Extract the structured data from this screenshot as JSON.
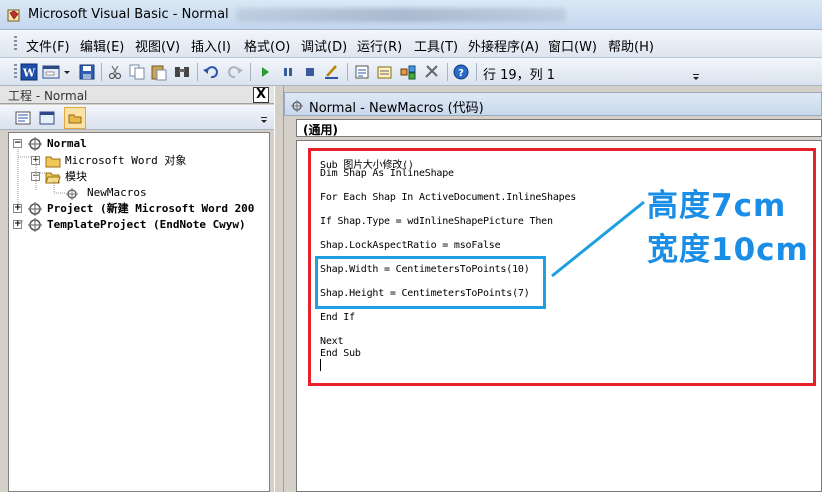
{
  "window": {
    "title": "Microsoft Visual Basic - Normal"
  },
  "menu": {
    "items": [
      "文件(F)",
      "编辑(E)",
      "视图(V)",
      "插入(I)",
      "格式(O)",
      "调试(D)",
      "运行(R)",
      "工具(T)",
      "外接程序(A)",
      "窗口(W)",
      "帮助(H)"
    ]
  },
  "toolbar": {
    "cursor_position": "行 19，列 1"
  },
  "project_explorer": {
    "title": "工程 - Normal",
    "close_label": "X",
    "tree": [
      {
        "label": "Normal",
        "expander": "−"
      },
      {
        "label": "Microsoft Word 对象",
        "expander": "+"
      },
      {
        "label": "模块",
        "expander": "−"
      },
      {
        "label": "NewMacros",
        "expander": ""
      },
      {
        "label": "Project (新建 Microsoft Word 200",
        "expander": "+"
      },
      {
        "label": "TemplateProject (EndNote Cwyw)",
        "expander": "+"
      }
    ]
  },
  "code_window": {
    "title": "Normal - NewMacros (代码)",
    "object_combo": "(通用)",
    "lines": [
      "Sub 图片大小修改()",
      "Dim Shap As InlineShape",
      "",
      "For Each Shap In ActiveDocument.InlineShapes",
      "",
      "If Shap.Type = wdInlineShapePicture Then",
      "",
      "Shap.LockAspectRatio = msoFalse",
      "",
      "Shap.Width = CentimetersToPoints(10)",
      "",
      "Shap.Height = CentimetersToPoints(7)",
      "",
      "End If",
      "",
      "Next",
      "End Sub"
    ]
  },
  "annotation": {
    "line1": "高度7cm",
    "line2": "宽度10cm",
    "color_red": "#e8202a",
    "color_blue": "#1f9ee0"
  },
  "icons": [
    "app-icon",
    "word-icon",
    "form-icon",
    "save-icon",
    "cut-icon",
    "copy-icon",
    "paste-icon",
    "find-icon",
    "undo-icon",
    "redo-icon",
    "run-icon",
    "pause-icon",
    "stop-icon",
    "design-icon",
    "project-icon",
    "properties-icon",
    "object-browser-icon",
    "toolbox-icon",
    "help-icon",
    "view-code-icon",
    "view-object-icon",
    "toggle-folders-icon",
    "module-icon",
    "folder-icon"
  ]
}
